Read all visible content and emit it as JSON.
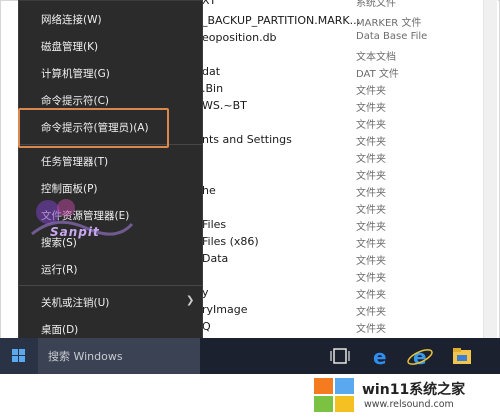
{
  "file_list": {
    "rows": [
      {
        "name": "XT",
        "type": "系统文件"
      },
      {
        "name": "_BACKUP_PARTITION.MARK...",
        "type": "MARKER 文件"
      },
      {
        "name": "eoposition.db",
        "type": "Data Base File"
      },
      {
        "name": "",
        "type": "文本文档"
      },
      {
        "name": "dat",
        "type": "DAT 文件"
      },
      {
        "name": ".Bin",
        "type": "文件夹"
      },
      {
        "name": "WS.~BT",
        "type": "文件夹"
      },
      {
        "name": "",
        "type": "文件夹"
      },
      {
        "name": "nts and Settings",
        "type": "文件夹"
      },
      {
        "name": "",
        "type": "文件夹"
      },
      {
        "name": "",
        "type": "文件夹"
      },
      {
        "name": "he",
        "type": "文件夹"
      },
      {
        "name": "",
        "type": "文件夹"
      },
      {
        "name": "Files",
        "type": "文件夹"
      },
      {
        "name": "Files (x86)",
        "type": "文件夹"
      },
      {
        "name": "Data",
        "type": "文件夹"
      },
      {
        "name": "",
        "type": "文件夹"
      },
      {
        "name": "y",
        "type": "文件夹"
      },
      {
        "name": "ryImage",
        "type": "文件夹"
      },
      {
        "name": "Q",
        "type": "文件夹"
      }
    ]
  },
  "start_menu": {
    "items": [
      {
        "label": "网络连接(W)"
      },
      {
        "label": "磁盘管理(K)"
      },
      {
        "label": "计算机管理(G)"
      },
      {
        "label": "命令提示符(C)"
      },
      {
        "label": "命令提示符(管理员)(A)"
      },
      {
        "label": "任务管理器(T)"
      },
      {
        "label": "控制面板(P)"
      },
      {
        "label": "文件资源管理器(E)"
      },
      {
        "label": "搜索(S)"
      },
      {
        "label": "运行(R)"
      },
      {
        "label": "关机或注销(U)"
      },
      {
        "label": "桌面(D)"
      }
    ]
  },
  "watermark": {
    "text": "Sanpit"
  },
  "taskbar": {
    "search_placeholder": "搜索 Windows"
  },
  "footer": {
    "brand": "win11系统之家",
    "url": "www.relsound.com"
  },
  "colors": {
    "menu_bg": "#2b2b2b",
    "highlight_border": "#d9894f",
    "taskbar_bg": "#1c2130"
  }
}
